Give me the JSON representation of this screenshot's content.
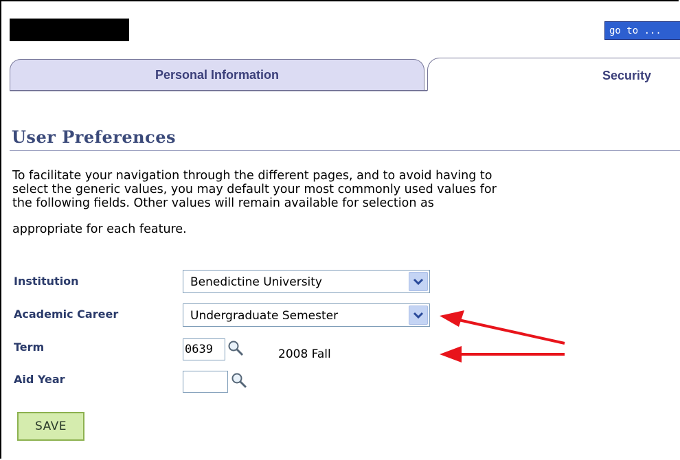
{
  "header": {
    "goto_label": "go to ..."
  },
  "tabs": [
    {
      "label": "Personal Information",
      "active": false
    },
    {
      "label": "Security",
      "active": true
    }
  ],
  "page": {
    "title": "User Preferences",
    "description_lines": [
      "To facilitate your navigation through the different pages, and to avoid having to",
      "select the generic values, you may default your most commonly used values for",
      "the following fields. Other values will remain available for selection as",
      "appropriate for each feature."
    ]
  },
  "form": {
    "institution": {
      "label": "Institution",
      "value": "Benedictine University"
    },
    "academic_career": {
      "label": "Academic Career",
      "value": "Undergraduate Semester"
    },
    "term": {
      "label": "Term",
      "value": "0639",
      "description": "2008 Fall"
    },
    "aid_year": {
      "label": "Aid Year",
      "value": ""
    }
  },
  "buttons": {
    "save_label": "SAVE"
  },
  "icons": {
    "lookup": "magnifier-icon",
    "dropdown": "chevron-down-icon",
    "annotation": "red-arrow-icon"
  },
  "colors": {
    "accent": "#3b4a7a",
    "annotation": "#e8141b",
    "save_bg": "#d5ecae",
    "goto_bg": "#2d5fd0"
  }
}
